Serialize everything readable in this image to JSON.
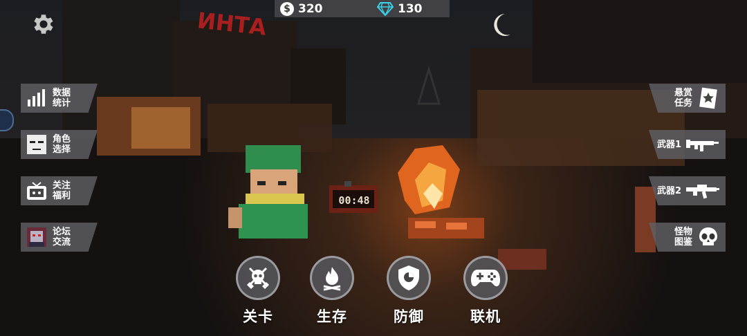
{
  "hud": {
    "coins": "320",
    "gems": "130",
    "gem_color": "#38d3e8",
    "coin_icon_glyph": "$"
  },
  "timer": {
    "display": "00:48"
  },
  "left_menu": [
    {
      "id": "stats",
      "label": "数据统计",
      "icon": "bar-chart-icon"
    },
    {
      "id": "character",
      "label": "角色选择",
      "icon": "character-face-icon"
    },
    {
      "id": "follow",
      "label": "关注福利",
      "icon": "tv-icon"
    },
    {
      "id": "forum",
      "label": "论坛交流",
      "icon": "forum-avatar-icon"
    }
  ],
  "right_menu": [
    {
      "id": "bounty",
      "label": "悬赏任务",
      "icon": "bounty-badge-icon"
    },
    {
      "id": "weapon1",
      "label": "武器1",
      "icon": "smg-icon"
    },
    {
      "id": "weapon2",
      "label": "武器2",
      "icon": "rifle-icon"
    },
    {
      "id": "bestiary",
      "label": "怪物图鉴",
      "icon": "skull-icon"
    }
  ],
  "modes": [
    {
      "id": "levels",
      "label": "关卡",
      "icon": "skull-crossed-axes-icon"
    },
    {
      "id": "survival",
      "label": "生存",
      "icon": "campfire-icon"
    },
    {
      "id": "defense",
      "label": "防御",
      "icon": "shield-icon"
    },
    {
      "id": "online",
      "label": "联机",
      "icon": "gamepad-icon"
    }
  ],
  "scene_text": {
    "sign": "ИНТА"
  }
}
